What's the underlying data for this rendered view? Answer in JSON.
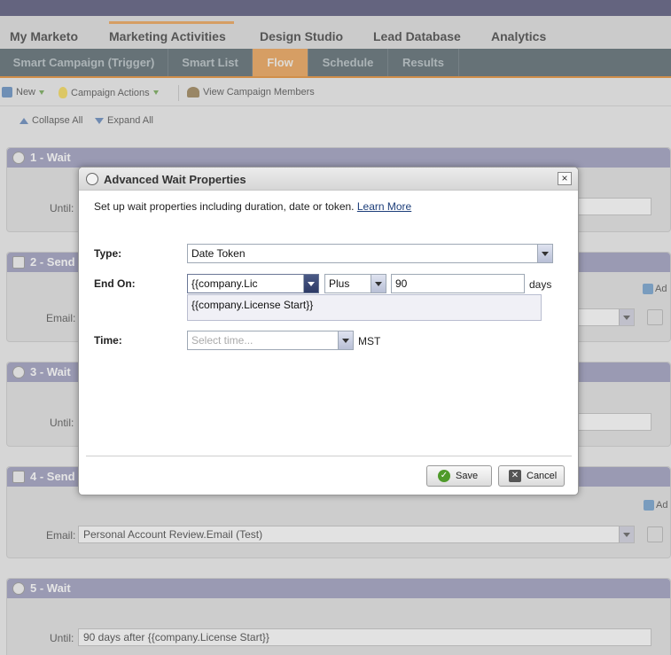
{
  "main_nav": [
    "My Marketo",
    "Marketing Activities",
    "Design Studio",
    "Lead Database",
    "Analytics"
  ],
  "sub_tabs": [
    "Smart Campaign (Trigger)",
    "Smart List",
    "Flow",
    "Schedule",
    "Results"
  ],
  "toolbar": {
    "new_label": "New",
    "campaign_actions_label": "Campaign Actions",
    "view_members_label": "View Campaign Members"
  },
  "collapse": {
    "collapse_label": "Collapse All",
    "expand_label": "Expand All"
  },
  "steps": [
    {
      "title": "1 - Wait",
      "field_label": "Until:",
      "field_value": ""
    },
    {
      "title": "2 - Send",
      "field_label": "Email:",
      "field_value": ""
    },
    {
      "title": "3 - Wait",
      "field_label": "Until:",
      "field_value": ""
    },
    {
      "title": "4 - Send",
      "field_label": "Email:",
      "field_value": "Personal Account Review.Email (Test)",
      "add_label": "Ad"
    },
    {
      "title": "5 - Wait",
      "field_label": "Until:",
      "field_value": "90 days after {{company.License Start}}"
    }
  ],
  "dialog": {
    "title": "Advanced Wait Properties",
    "intro": "Set up wait properties including duration, date or token.",
    "learn_more": "Learn More",
    "type_label": "Type:",
    "type_value": "Date Token",
    "end_on_label": "End On:",
    "token_value": "{{company.Lic",
    "operator_value": "Plus",
    "amount_value": "90",
    "unit_label": "days",
    "suggestion": "{{company.License Start}}",
    "time_label": "Time:",
    "time_placeholder": "Select time...",
    "timezone": "MST",
    "save_label": "Save",
    "cancel_label": "Cancel"
  },
  "colors": {
    "accent": "#e8933a",
    "header": "#8d8db3",
    "subnav": "#3d4f57"
  }
}
